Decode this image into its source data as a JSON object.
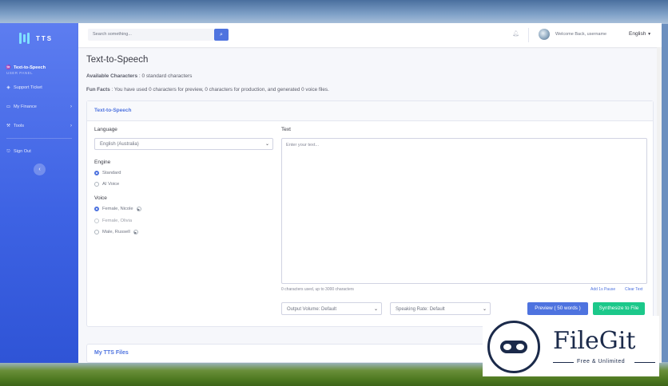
{
  "brand": {
    "name": "TTS"
  },
  "search": {
    "placeholder": "Search something..."
  },
  "header": {
    "welcome": "Welcome Back, username",
    "language": "English"
  },
  "sidebar": {
    "section": "USER PANEL",
    "items": [
      {
        "label": "Text-to-Speech",
        "icon": "waveform-icon"
      },
      {
        "label": "Support Ticket",
        "icon": "tag-icon"
      },
      {
        "label": "My Finance",
        "icon": "wallet-icon"
      },
      {
        "label": "Tools",
        "icon": "wrench-icon"
      },
      {
        "label": "Sign Out",
        "icon": "sign-out-icon"
      }
    ]
  },
  "page": {
    "title": "Text-to-Speech",
    "available_label": "Available Characters",
    "available_value": ": 0 standard characters",
    "facts_label": "Fun Facts",
    "facts_text": ": You have used 0 characters for preview, 0 characters for production, and generated 0 voice files."
  },
  "tts_card": {
    "title": "Text-to-Speech",
    "language_label": "Language",
    "language_value": "English (Australia)",
    "engine_label": "Engine",
    "engine_options": [
      "Standard",
      "AI Voice"
    ],
    "voice_label": "Voice",
    "voice_options": [
      "Female, Nicole",
      "Female, Olivia",
      "Male, Russell"
    ],
    "text_label": "Text",
    "text_placeholder": "Enter your text...",
    "char_count": "0 characters used, up to 3000 characters",
    "add_pause": "Add 1s Pause",
    "clear_text": "Clear Text",
    "output_volume": "Output Volume: Default",
    "speaking_rate": "Speaking Rate: Default",
    "preview_button": "Preview ( 50 words )",
    "synthesize_button": "Synthesize to File"
  },
  "files_card": {
    "title": "My TTS Files"
  },
  "watermark": {
    "title": "FileGit",
    "subtitle": "Free & Unlimited"
  }
}
